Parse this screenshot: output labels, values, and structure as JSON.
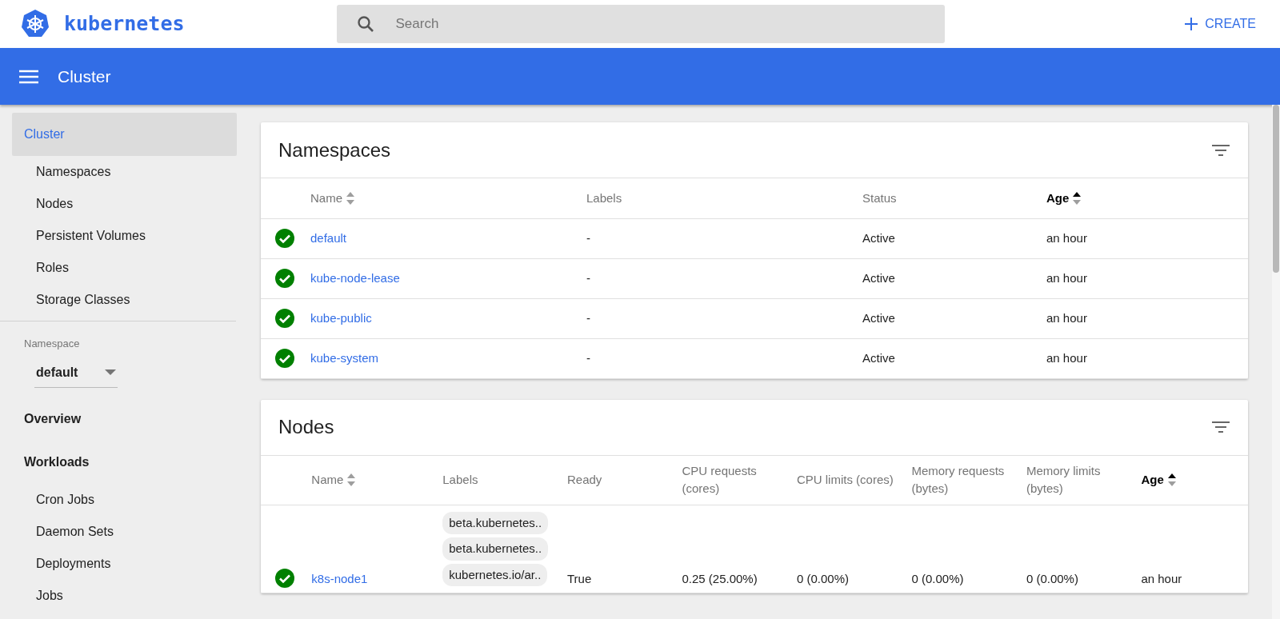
{
  "app": {
    "logo_text": "kubernetes",
    "search": {
      "placeholder": "Search"
    },
    "create_button": "CREATE"
  },
  "toolbar": {
    "title": "Cluster"
  },
  "sidebar": {
    "cluster_items": [
      {
        "label": "Cluster",
        "kind": "section",
        "selected": true
      },
      {
        "label": "Namespaces",
        "kind": "item",
        "selected": false
      },
      {
        "label": "Nodes",
        "kind": "item",
        "selected": false
      },
      {
        "label": "Persistent Volumes",
        "kind": "item",
        "selected": false
      },
      {
        "label": "Roles",
        "kind": "item",
        "selected": false
      },
      {
        "label": "Storage Classes",
        "kind": "item",
        "selected": false
      }
    ],
    "namespace": {
      "label": "Namespace",
      "value": "default"
    },
    "nav_items": [
      {
        "label": "Overview",
        "kind": "section",
        "selected": false
      },
      {
        "label": "Workloads",
        "kind": "section",
        "selected": false
      },
      {
        "label": "Cron Jobs",
        "kind": "item",
        "selected": false
      },
      {
        "label": "Daemon Sets",
        "kind": "item",
        "selected": false
      },
      {
        "label": "Deployments",
        "kind": "item",
        "selected": false
      },
      {
        "label": "Jobs",
        "kind": "item",
        "selected": false
      }
    ]
  },
  "cards": [
    {
      "title": "Namespaces",
      "columns": [
        {
          "label": "Name",
          "sortable": true,
          "sorted": false
        },
        {
          "label": "Labels",
          "sortable": false,
          "sorted": false
        },
        {
          "label": "Status",
          "sortable": false,
          "sorted": false
        },
        {
          "label": "Age",
          "sortable": true,
          "sorted": true
        }
      ],
      "rows": [
        {
          "healthy": true,
          "cells": [
            "default",
            "-",
            "Active",
            "an hour"
          ]
        },
        {
          "healthy": true,
          "cells": [
            "kube-node-lease",
            "-",
            "Active",
            "an hour"
          ]
        },
        {
          "healthy": true,
          "cells": [
            "kube-public",
            "-",
            "Active",
            "an hour"
          ]
        },
        {
          "healthy": true,
          "cells": [
            "kube-system",
            "-",
            "Active",
            "an hour"
          ]
        }
      ]
    },
    {
      "title": "Nodes",
      "columns": [
        {
          "label": "Name",
          "sortable": true,
          "sorted": false
        },
        {
          "label": "Labels",
          "sortable": false,
          "sorted": false
        },
        {
          "label": "Ready",
          "sortable": false,
          "sorted": false
        },
        {
          "label": "CPU requests (cores)",
          "sortable": false,
          "sorted": false
        },
        {
          "label": "CPU limits (cores)",
          "sortable": false,
          "sorted": false
        },
        {
          "label": "Memory requests (bytes)",
          "sortable": false,
          "sorted": false
        },
        {
          "label": "Memory limits (bytes)",
          "sortable": false,
          "sorted": false
        },
        {
          "label": "Age",
          "sortable": true,
          "sorted": true
        }
      ],
      "rows": [
        {
          "healthy": true,
          "cells": [
            "k8s-node1",
            [
              "beta.kubernetes..",
              "beta.kubernetes..",
              "kubernetes.io/ar.."
            ],
            "True",
            "0.25 (25.00%)",
            "0 (0.00%)",
            "0 (0.00%)",
            "0 (0.00%)",
            "an hour"
          ]
        }
      ]
    }
  ]
}
